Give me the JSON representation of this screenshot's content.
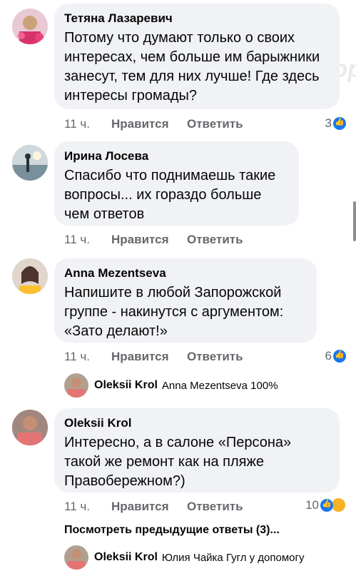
{
  "comments": [
    {
      "author": "Тетяна Лазаревич",
      "text": "Потому что думают только о своих интересах, чем больше им барыжники занесут, тем для них лучше! Где здесь интересы громады?",
      "time": "11 ч.",
      "like": "Нравится",
      "reply": "Ответить",
      "reactions_count": "3"
    },
    {
      "author": "Ирина Лосева",
      "text": "Спасибо что поднимаешь такие вопросы... их гораздо больше чем ответов",
      "time": "11 ч.",
      "like": "Нравится",
      "reply": "Ответить",
      "reactions_count": ""
    },
    {
      "author": "Anna Mezentseva",
      "text": "Напишите в любой Запорожской группе - накинутся с аргументом: «Зато делают!»",
      "time": "11 ч.",
      "like": "Нравится",
      "reply": "Ответить",
      "reactions_count": "6"
    },
    {
      "author": "Oleksii Krol",
      "text": "Интересно, а в салоне «Персона» такой же ремонт как на пляже Правобережном?)",
      "time": "11 ч.",
      "like": "Нравится",
      "reply": "Ответить",
      "reactions_count": "10"
    }
  ],
  "replies": [
    {
      "author": "Oleksii Krol",
      "text": "Anna Mezentseva 100%"
    },
    {
      "author": "Oleksii Krol",
      "text": "Юлия Чайка Гугл у допомогу"
    }
  ],
  "more_replies_label": "Посмотреть предыдущие ответы (3)...",
  "watermark_text": "Запор",
  "colors": {
    "bubble": "#f0f2f5",
    "meta": "#65676b",
    "like_blue": "#1877f2",
    "haha_yellow": "#f7b125"
  }
}
